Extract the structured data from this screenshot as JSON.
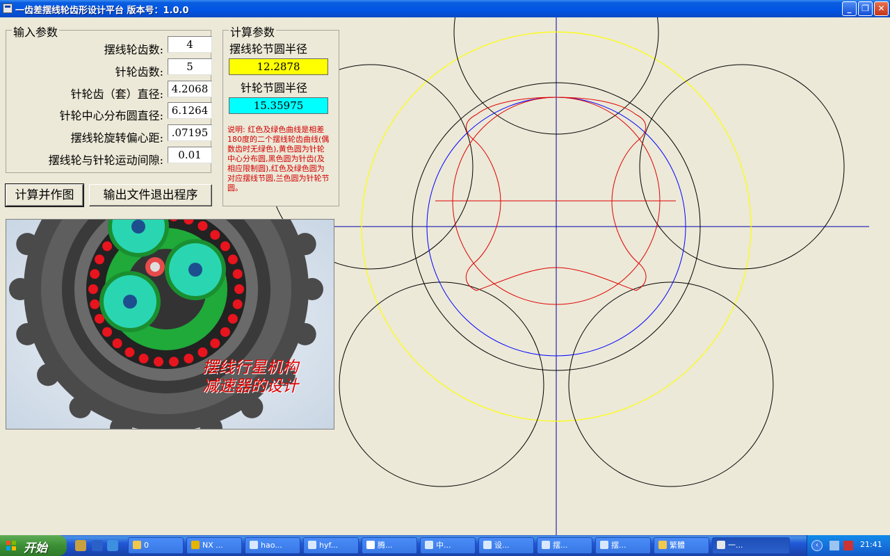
{
  "window": {
    "title": "一齿差摆线轮齿形设计平台   版本号：1.0.0",
    "buttons": {
      "minimize": "_",
      "maximize": "❐",
      "close": "✕"
    }
  },
  "input_group": {
    "title": "输入参数",
    "rows": [
      {
        "label": "摆线轮齿数:",
        "value": "4"
      },
      {
        "label": "针轮齿数:",
        "value": "5"
      },
      {
        "label": "针轮齿（套）直径:",
        "value": "4.2068"
      },
      {
        "label": "针轮中心分布圆直径:",
        "value": "6.1264"
      },
      {
        "label": "摆线轮旋转偏心距:",
        "value": ".07195"
      },
      {
        "label": "摆线轮与针轮运动间隙:",
        "value": "0.01"
      }
    ]
  },
  "calc_group": {
    "title": "计算参数",
    "cycloid_pitch_label": "摆线轮节圆半径",
    "cycloid_pitch_value": "12.2878",
    "pin_pitch_label": "针轮节圆半径",
    "pin_pitch_value": "15.35975",
    "note": "说明: 红色及绿色曲线是相差180度的二个摆线轮齿曲线(偶数齿时无绿色),黄色圆为针轮中心分布圆,黑色圆为针齿(及相应限制圆),红色及绿色圆为对应摆线节圆,兰色圆为针轮节圆。",
    "colors": {
      "cycloid_box": "#ffff00",
      "pin_box": "#00ffff",
      "note_text": "#d20000"
    }
  },
  "actions": {
    "calculate_label": "计算并作图",
    "export_label": "输出文件退出程序"
  },
  "picture": {
    "caption_line1": "摆线行星机构",
    "caption_line2": "减速器的设计"
  },
  "drawing": {
    "colors": {
      "pin_distribution_circle": "#ffff00",
      "pin_circles": "#000000",
      "cycloid_profile": "#e00000",
      "pin_pitch_circle": "#0000ff",
      "axes": "#0000aa"
    }
  },
  "taskbar": {
    "start_label": "开始",
    "items": [
      {
        "label": "0",
        "icon": "folder-icon"
      },
      {
        "label": "NX ...",
        "icon": "nx-icon"
      },
      {
        "label": "hao...",
        "icon": "ie-icon"
      },
      {
        "label": "hyf...",
        "icon": "ie-icon"
      },
      {
        "label": "腾...",
        "icon": "browser-icon"
      },
      {
        "label": "中...",
        "icon": "ie-icon"
      },
      {
        "label": "设...",
        "icon": "ie-icon"
      },
      {
        "label": "摆...",
        "icon": "ie-icon"
      },
      {
        "label": "摆...",
        "icon": "ie-icon"
      },
      {
        "label": "繁體",
        "icon": "folder-icon"
      },
      {
        "label": "一...",
        "icon": "app-icon"
      }
    ],
    "clock": "21:41"
  }
}
